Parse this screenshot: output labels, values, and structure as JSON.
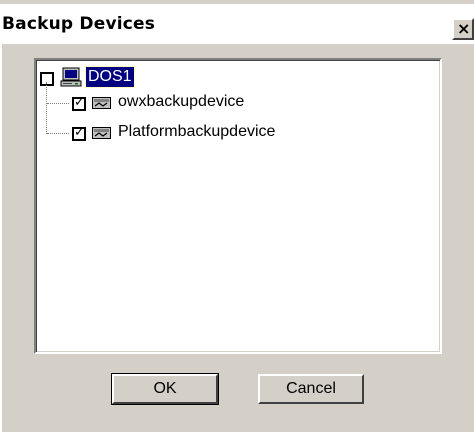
{
  "window": {
    "title": "Backup Devices",
    "close_glyph": "×"
  },
  "tree": {
    "root": {
      "label": "DOS1",
      "checked": false,
      "selected": true,
      "icon": "computer-icon"
    },
    "children": [
      {
        "label": "owxbackupdevice",
        "checked": true,
        "icon": "tape-device-icon"
      },
      {
        "label": "Platformbackupdevice",
        "checked": true,
        "icon": "tape-device-icon"
      }
    ],
    "check_glyph": "✓"
  },
  "buttons": {
    "ok_label": "OK",
    "cancel_label": "Cancel"
  },
  "colors": {
    "dialog_face": "#d4d0c8",
    "selection_bg": "#000080",
    "selection_fg": "#ffffff"
  }
}
